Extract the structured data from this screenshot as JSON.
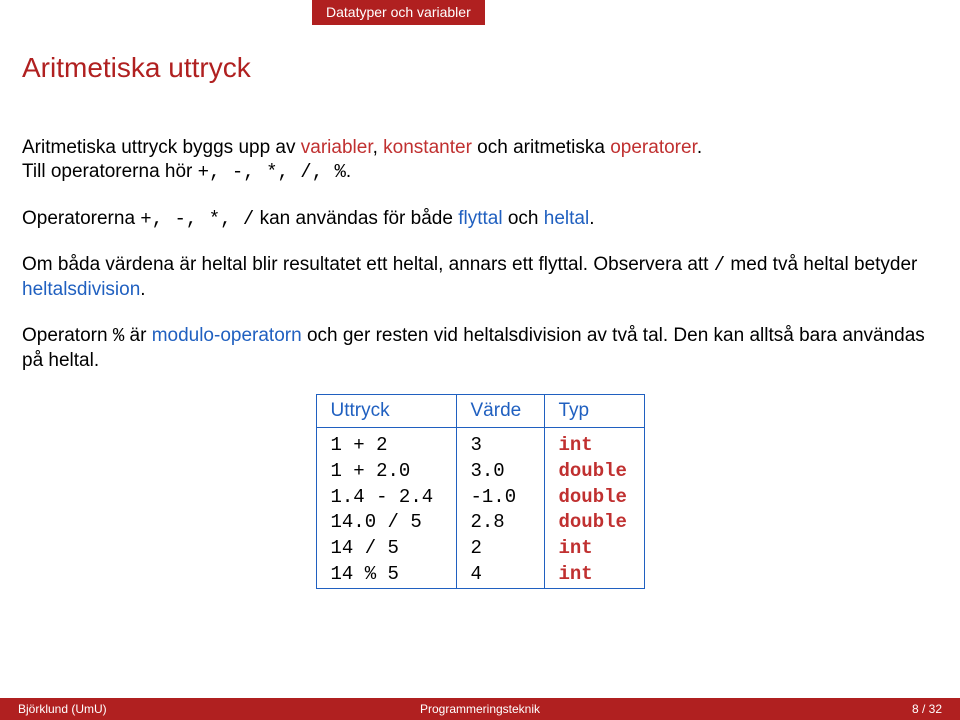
{
  "header": {
    "section": "Datatyper och variabler"
  },
  "title": "Aritmetiska uttryck",
  "paragraphs": {
    "p1_a": "Aritmetiska uttryck byggs upp av ",
    "p1_var": "variabler",
    "p1_b": ", ",
    "p1_kon": "konstanter",
    "p1_c": " och aritmetiska ",
    "p1_op": "operatorer",
    "p1_d": ".",
    "p1_e": "Till operatorerna hör ",
    "p1_ops": "+, -, *, /, %",
    "p1_f": ".",
    "p2_a": "Operatorerna ",
    "p2_ops": "+, -, *, /",
    "p2_b": " kan användas för både ",
    "p2_fly": "flyttal",
    "p2_c": " och ",
    "p2_hel": "heltal",
    "p2_d": ".",
    "p3_a": "Om båda värdena är heltal blir resultatet ett heltal, annars ett flyttal. Observera att ",
    "p3_slash": "/",
    "p3_b": " med två heltal betyder ",
    "p3_div": "heltalsdivision",
    "p3_c": ".",
    "p4_a": "Operatorn ",
    "p4_pct": "%",
    "p4_b": " är ",
    "p4_mod": "modulo-operatorn",
    "p4_c": " och ger resten vid heltalsdivision av två tal. Den kan alltså bara användas på heltal."
  },
  "table": {
    "headers": [
      "Uttryck",
      "Värde",
      "Typ"
    ],
    "rows": [
      {
        "expr": "1 + 2",
        "val": "3",
        "typ": "int"
      },
      {
        "expr": "1 + 2.0",
        "val": "3.0",
        "typ": "double"
      },
      {
        "expr": "1.4 - 2.4",
        "val": "-1.0",
        "typ": "double"
      },
      {
        "expr": "14.0 / 5",
        "val": "2.8",
        "typ": "double"
      },
      {
        "expr": "14 / 5",
        "val": "2",
        "typ": "int"
      },
      {
        "expr": "14 % 5",
        "val": "4",
        "typ": "int"
      }
    ]
  },
  "footer": {
    "left": "Björklund (UmU)",
    "center": "Programmeringsteknik",
    "right": "8 / 32"
  }
}
